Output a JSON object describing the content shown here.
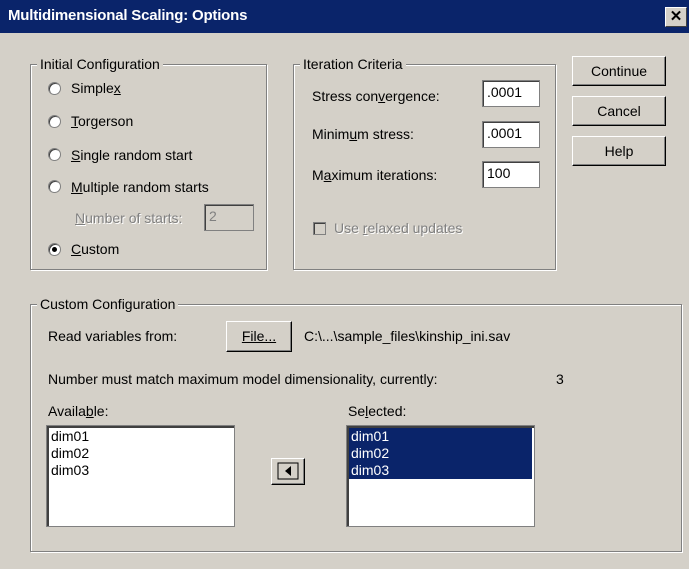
{
  "window": {
    "title": "Multidimensional Scaling: Options",
    "close_label": "✕"
  },
  "initial_configuration": {
    "label": "Initial Configuration",
    "options": [
      {
        "label": "Simplex",
        "selected": false
      },
      {
        "label": "Torgerson",
        "selected": false
      },
      {
        "label": "Single random start",
        "selected": false
      },
      {
        "label": "Multiple random starts",
        "selected": false
      },
      {
        "label": "Custom",
        "selected": true
      }
    ],
    "number_of_starts": {
      "label": "Number of starts:",
      "value": "2"
    }
  },
  "iteration_criteria": {
    "label": "Iteration Criteria",
    "stress_convergence": {
      "label": "Stress convergence:",
      "value": ".0001"
    },
    "minimum_stress": {
      "label": "Minimum stress:",
      "value": ".0001"
    },
    "maximum_iterations": {
      "label": "Maximum iterations:",
      "value": "100"
    },
    "relaxed_updates": {
      "label": "Use relaxed updates",
      "checked": false
    }
  },
  "buttons": {
    "continue": "Continue",
    "cancel": "Cancel",
    "help": "Help"
  },
  "custom_configuration": {
    "label": "Custom Configuration",
    "read_label": "Read variables from:",
    "file_button": "File...",
    "file_path": "C:\\...\\sample_files\\kinship_ini.sav",
    "note": "Number must match maximum model dimensionality, currently:",
    "dimensionality": "3",
    "available_label": "Available:",
    "selected_label": "Selected:",
    "available": [
      "dim01",
      "dim02",
      "dim03"
    ],
    "selected": [
      "dim01",
      "dim02",
      "dim03"
    ],
    "move_icon": "left-arrow-icon"
  }
}
